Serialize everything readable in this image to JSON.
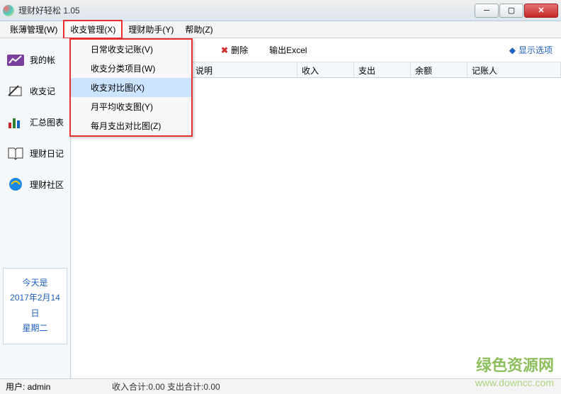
{
  "title": "理财好轻松 1.05",
  "menus": {
    "accounts": "账薄管理(W)",
    "income": "收支管理(X)",
    "assistant": "理财助手(Y)",
    "help": "帮助(Z)"
  },
  "dropdown": {
    "daily": "日常收支记账(V)",
    "category": "收支分类项目(W)",
    "compare": "收支对比图(X)",
    "monthly": "月平均收支图(Y)",
    "expense": "每月支出对比图(Z)"
  },
  "sidebar": {
    "myaccount": "我的帐",
    "income": "收支记",
    "summary": "汇总图表",
    "diary": "理财日记",
    "community": "理财社区"
  },
  "datebox": {
    "today": "今天是",
    "date": "2017年2月14日",
    "weekday": "星期二"
  },
  "toolbar": {
    "delete": "删除",
    "export": "输出Excel",
    "showopts": "显示选项"
  },
  "columns": {
    "c1": "",
    "c2": "说明",
    "c3": "收入",
    "c4": "支出",
    "c5": "余额",
    "c6": "记账人"
  },
  "status": {
    "user": "用户: admin",
    "totals": "收入合计:0.00 支出合计:0.00"
  },
  "watermark": {
    "text": "绿色资源网",
    "url": "www.downcc.com"
  }
}
